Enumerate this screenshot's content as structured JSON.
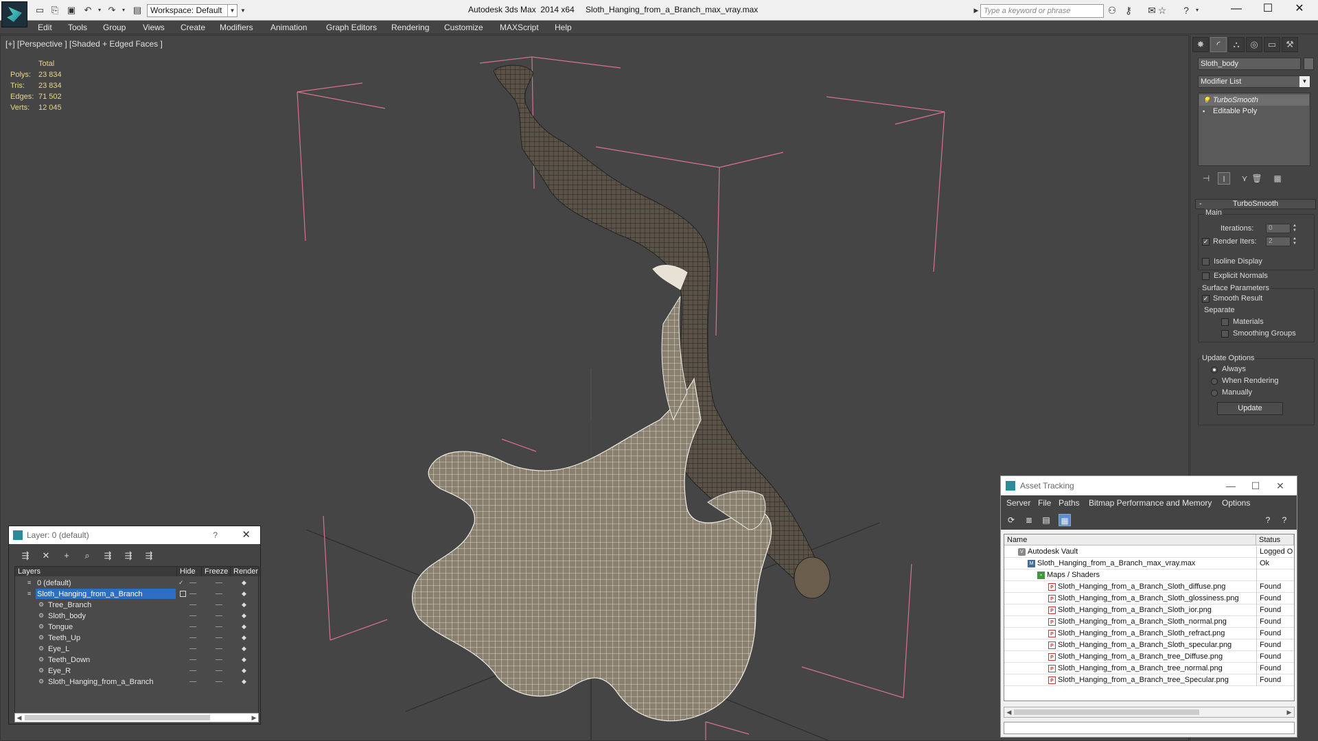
{
  "app": {
    "title": "Autodesk 3ds Max  2014 x64",
    "file": "Sloth_Hanging_from_a_Branch_max_vray.max",
    "workspace": "Workspace: Default",
    "search_placeholder": "Type a keyword or phrase"
  },
  "menu": [
    "Edit",
    "Tools",
    "Group",
    "Views",
    "Create",
    "Modifiers",
    "Animation",
    "Graph Editors",
    "Rendering",
    "Customize",
    "MAXScript",
    "Help"
  ],
  "viewport": {
    "label": "[+] [Perspective ] [Shaded + Edged Faces ]",
    "stats": {
      "header": "Total",
      "rows": [
        {
          "label": "Polys:",
          "value": "23 834"
        },
        {
          "label": "Tris:",
          "value": "23 834"
        },
        {
          "label": "Edges:",
          "value": "71 502"
        },
        {
          "label": "Verts:",
          "value": "12 045"
        }
      ]
    }
  },
  "command_panel": {
    "object_name": "Sloth_body",
    "modifier_list": "Modifier List",
    "stack": [
      "TurboSmooth",
      "Editable Poly"
    ],
    "turbosmooth": {
      "title": "TurboSmooth",
      "main_group": "Main",
      "iterations_label": "Iterations:",
      "iterations_value": "0",
      "render_iters_label": "Render Iters:",
      "render_iters_value": "2",
      "render_iters_checked": true,
      "isoline_label": "Isoline Display",
      "explicit_normals_label": "Explicit Normals",
      "surface_group": "Surface Parameters",
      "smooth_result_label": "Smooth Result",
      "separate_label": "Separate",
      "materials_label": "Materials",
      "smoothing_groups_label": "Smoothing Groups",
      "update_group": "Update Options",
      "always_label": "Always",
      "when_rendering_label": "When Rendering",
      "manually_label": "Manually",
      "update_button": "Update"
    }
  },
  "layer_explorer": {
    "title": "Layer: 0 (default)",
    "help": "?",
    "columns": [
      "Layers",
      "Hide",
      "Freeze",
      "Render"
    ],
    "rows": [
      {
        "name": "0 (default)",
        "level": 0,
        "active": true
      },
      {
        "name": "Sloth_Hanging_from_a_Branch",
        "level": 0,
        "selected": true
      },
      {
        "name": "Tree_Branch",
        "level": 1
      },
      {
        "name": "Sloth_body",
        "level": 1
      },
      {
        "name": "Tongue",
        "level": 1
      },
      {
        "name": "Teeth_Up",
        "level": 1
      },
      {
        "name": "Eye_L",
        "level": 1
      },
      {
        "name": "Teeth_Down",
        "level": 1
      },
      {
        "name": "Eye_R",
        "level": 1
      },
      {
        "name": "Sloth_Hanging_from_a_Branch",
        "level": 1
      }
    ]
  },
  "asset_tracking": {
    "title": "Asset Tracking",
    "menu": [
      "Server",
      "File",
      "Paths",
      "Bitmap Performance and Memory",
      "Options"
    ],
    "columns": [
      "Name",
      "Status"
    ],
    "rows": [
      {
        "name": "Autodesk Vault",
        "status": "Logged O",
        "level": 0,
        "icon": "vault"
      },
      {
        "name": "Sloth_Hanging_from_a_Branch_max_vray.max",
        "status": "Ok",
        "level": 1,
        "icon": "max"
      },
      {
        "name": "Maps / Shaders",
        "status": "",
        "level": 2,
        "icon": "folder"
      },
      {
        "name": "Sloth_Hanging_from_a_Branch_Sloth_diffuse.png",
        "status": "Found",
        "level": 3,
        "icon": "png"
      },
      {
        "name": "Sloth_Hanging_from_a_Branch_Sloth_glossiness.png",
        "status": "Found",
        "level": 3,
        "icon": "png"
      },
      {
        "name": "Sloth_Hanging_from_a_Branch_Sloth_ior.png",
        "status": "Found",
        "level": 3,
        "icon": "png"
      },
      {
        "name": "Sloth_Hanging_from_a_Branch_Sloth_normal.png",
        "status": "Found",
        "level": 3,
        "icon": "png"
      },
      {
        "name": "Sloth_Hanging_from_a_Branch_Sloth_refract.png",
        "status": "Found",
        "level": 3,
        "icon": "png"
      },
      {
        "name": "Sloth_Hanging_from_a_Branch_Sloth_specular.png",
        "status": "Found",
        "level": 3,
        "icon": "png"
      },
      {
        "name": "Sloth_Hanging_from_a_Branch_tree_Diffuse.png",
        "status": "Found",
        "level": 3,
        "icon": "png"
      },
      {
        "name": "Sloth_Hanging_from_a_Branch_tree_normal.png",
        "status": "Found",
        "level": 3,
        "icon": "png"
      },
      {
        "name": "Sloth_Hanging_from_a_Branch_tree_Specular.png",
        "status": "Found",
        "level": 3,
        "icon": "png"
      }
    ]
  },
  "colors": {
    "accent": "#2e6dc4",
    "bbox": "#d8728f",
    "stats": "#e8d88a"
  }
}
